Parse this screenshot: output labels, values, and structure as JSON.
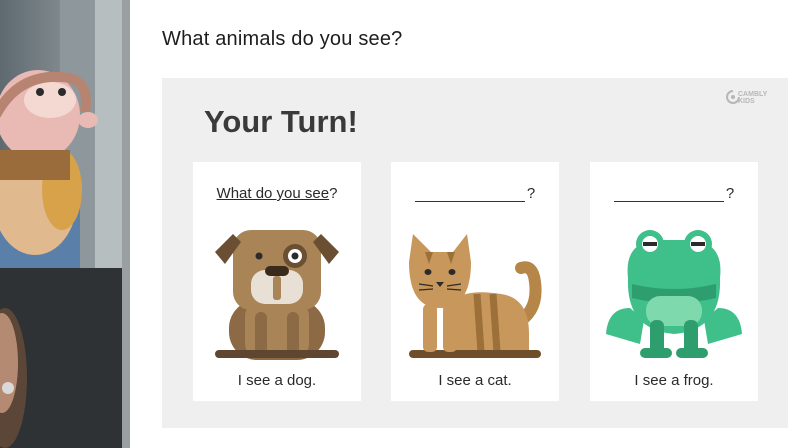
{
  "question": "What animals do you see?",
  "slide": {
    "title": "Your Turn!",
    "brand_line1": "CAMBLY",
    "brand_line2": "KIDS"
  },
  "cards": [
    {
      "prompt": "What do you see",
      "prompt_suffix": "?",
      "icon": "dog-icon",
      "caption": "I see a dog."
    },
    {
      "prompt": "",
      "prompt_suffix": "?",
      "icon": "cat-icon",
      "caption": "I see a cat."
    },
    {
      "prompt": "",
      "prompt_suffix": "?",
      "icon": "frog-icon",
      "caption": "I see a frog."
    }
  ],
  "colors": {
    "slide_bg": "#efefef",
    "dog_brown": "#a98457",
    "cat_tan": "#c7975b",
    "frog_green": "#3fbf8a"
  }
}
